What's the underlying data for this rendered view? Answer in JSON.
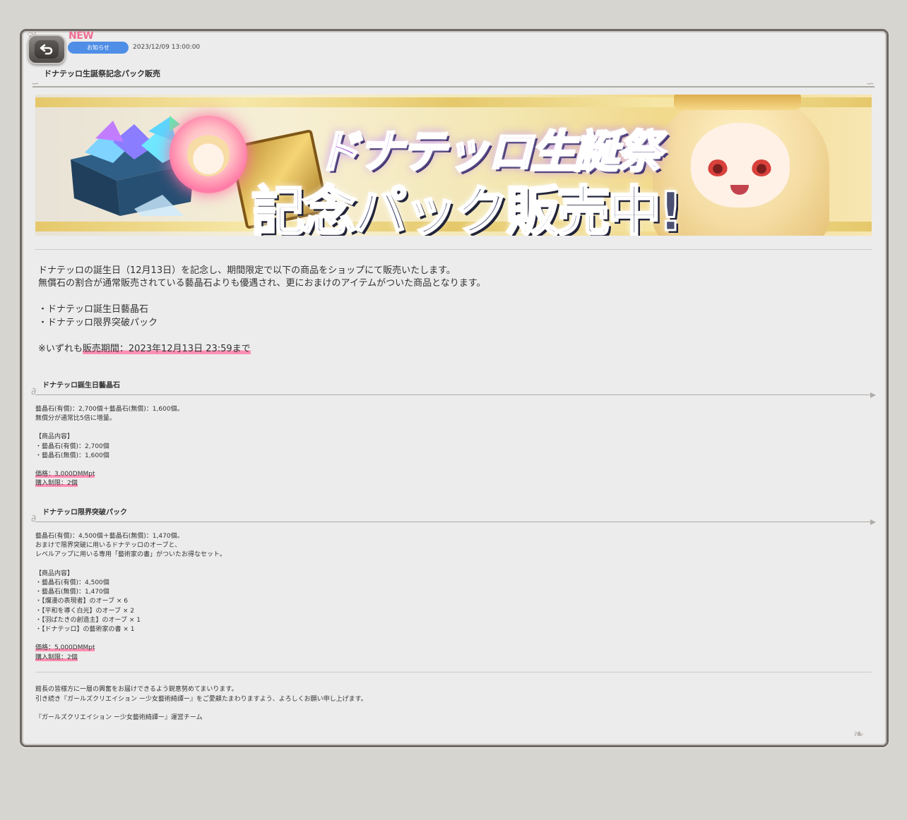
{
  "header": {
    "new_label": "NEW",
    "category": "お知らせ",
    "date": "2023/12/09 13:00:00",
    "title": "ドナテッロ生誕祭記念パック販売"
  },
  "banner": {
    "line1": "ドナテッロ生誕祭",
    "line2": "記念パック販売中!"
  },
  "intro": {
    "line1": "ドナテッロの誕生日（12月13日）を記念し、期間限定で以下の商品をショップにて販売いたします。",
    "line2": "無償石の割合が通常販売されている藝晶石よりも優遇され、更におまけのアイテムがついた商品となります。",
    "items": [
      "・ドナテッロ誕生日藝晶石",
      "・ドナテッロ限界突破パック"
    ],
    "period_prefix": "※いずれも",
    "period": "販売期間：2023年12月13日 23:59まで"
  },
  "section1": {
    "title": "ドナテッロ誕生日藝晶石",
    "desc": [
      "藝晶石(有償)：2,700個＋藝晶石(無償)：1,600個。",
      "無償分が通常比5倍に増量。"
    ],
    "contents_label": "【商品内容】",
    "contents": [
      "・藝晶石(有償)：2,700個",
      "・藝晶石(無償)：1,600個"
    ],
    "price": "価格：3,000DMMpt",
    "limit": "購入制限：2個"
  },
  "section2": {
    "title": "ドナテッロ限界突破パック",
    "desc": [
      "藝晶石(有償)：4,500個＋藝晶石(無償)：1,470個。",
      "おまけで限界突破に用いるドナテッロのオーブと、",
      "レベルアップに用いる専用「藝術家の書」がついたお得なセット。"
    ],
    "contents_label": "【商品内容】",
    "contents": [
      "・藝晶石(有償)：4,500個",
      "・藝晶石(無償)：1,470個",
      "・【爛漫の表現者】のオーブ × 6",
      "・【平和を導く白光】のオーブ × 2",
      "・【羽ばたきの創造主】のオーブ × 1",
      "・【ドナテッロ】の藝術家の書 × 1"
    ],
    "price": "価格：5,000DMMpt",
    "limit": "購入制限：2個"
  },
  "footer": {
    "line1": "館長の皆様方に一層の興奮をお届けできるよう鋭意努めてまいります。",
    "line2": "引き続き『ガールズクリエイション ー少女藝術綺譚ー』をご愛顧たまわりますよう、よろしくお願い申し上げます。",
    "signature": "『ガールズクリエイション ー少女藝術綺譚ー』運営チーム"
  },
  "colors": {
    "accent": "#4f8ee6",
    "highlight": "#ff8fb2",
    "new": "#f06e94",
    "frame": "#6e6866"
  }
}
